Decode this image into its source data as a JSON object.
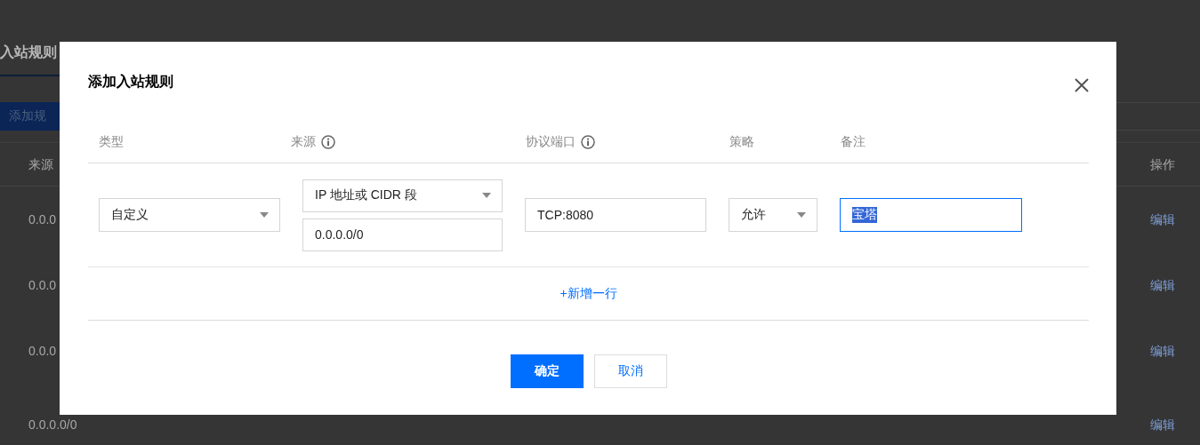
{
  "background": {
    "tab": {
      "label": "入站规则",
      "selected": true
    },
    "add_button": "添加规",
    "table": {
      "columns": [
        "来源",
        "操作"
      ],
      "rows": [
        {
          "source": "0.0.0",
          "action": "编辑"
        },
        {
          "source": "0.0.0",
          "action": "编辑"
        },
        {
          "source": "0.0.0",
          "action": "编辑"
        },
        {
          "source": "0.0.0.0/0",
          "action": "编辑"
        }
      ]
    }
  },
  "dialog": {
    "title": "添加入站规则",
    "columns": [
      {
        "label": "类型",
        "info": false
      },
      {
        "label": "来源",
        "info": true
      },
      {
        "label": "协议端口",
        "info": true
      },
      {
        "label": "策略",
        "info": false
      },
      {
        "label": "备注",
        "info": false
      }
    ],
    "rule": {
      "type": "自定义",
      "source_type": "IP 地址或 CIDR 段",
      "source": "0.0.0.0/0",
      "port": "TCP:8080",
      "policy": "允许",
      "note": {
        "value": "宝塔",
        "focused": true,
        "text_selected": true
      }
    },
    "add_row": "+新增一行",
    "buttons": [
      {
        "label": "确定",
        "primary": true
      },
      {
        "label": "取消",
        "primary": false
      }
    ]
  }
}
